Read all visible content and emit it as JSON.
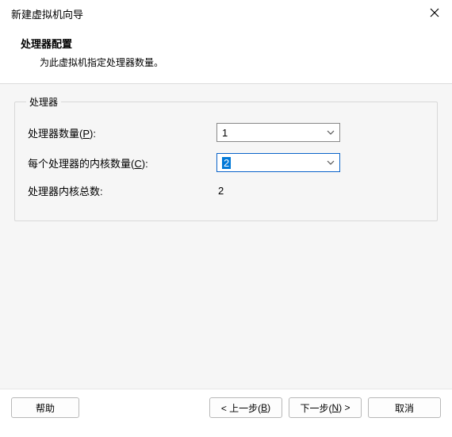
{
  "window": {
    "title": "新建虚拟机向导"
  },
  "header": {
    "title": "处理器配置",
    "subtitle": "为此虚拟机指定处理器数量。"
  },
  "group": {
    "legend": "处理器",
    "rows": {
      "processorCount": {
        "label_pre": "处理器数量(",
        "accel": "P",
        "label_post": "):",
        "value": "1"
      },
      "coresPerProcessor": {
        "label_pre": "每个处理器的内核数量(",
        "accel": "C",
        "label_post": "):",
        "value": "2"
      },
      "totalCores": {
        "label": "处理器内核总数:",
        "value": "2"
      }
    }
  },
  "footer": {
    "help": "帮助",
    "back_pre": "< 上一步(",
    "back_accel": "B",
    "back_post": ")",
    "next_pre": "下一步(",
    "next_accel": "N",
    "next_post": ") >",
    "cancel": "取消"
  }
}
